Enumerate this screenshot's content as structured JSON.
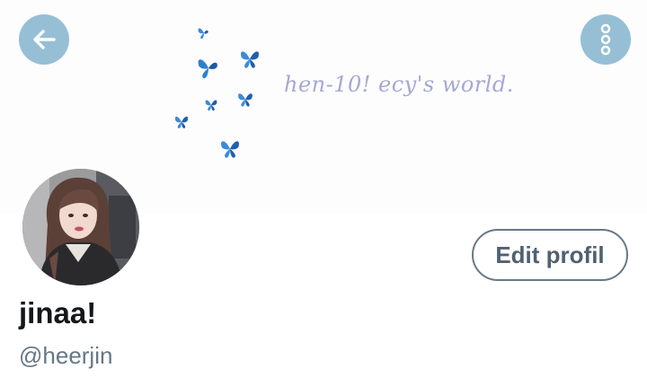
{
  "banner": {
    "text": "hen-10! ecy's world.",
    "butterfly_color": "#2f7fd0"
  },
  "nav": {
    "back_icon": "arrow-left-icon",
    "more_icon": "more-vertical-icon",
    "button_color": "#96bfd5"
  },
  "profile": {
    "edit_label": "Edit profil",
    "display_name": "jinaa!",
    "handle": "@heerjin"
  }
}
